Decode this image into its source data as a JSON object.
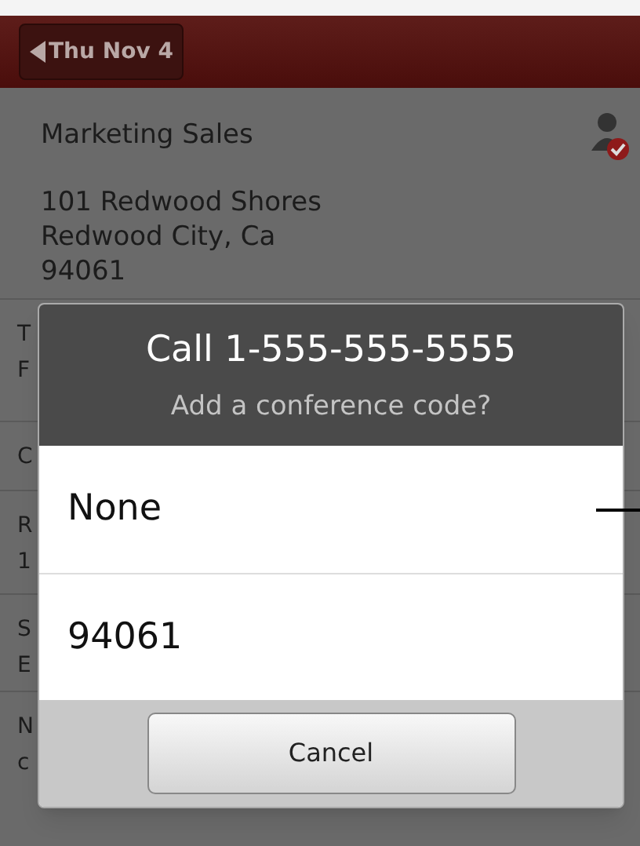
{
  "header": {
    "back_button": "Thu Nov 4"
  },
  "event": {
    "title": "Marketing Sales",
    "address": [
      "101 Redwood Shores",
      "Redwood City, Ca",
      "94061"
    ]
  },
  "background_rows": [
    {
      "lines": [
        "T",
        "F"
      ]
    },
    {
      "lines": [
        "C"
      ]
    },
    {
      "lines": [
        "R",
        "1"
      ]
    },
    {
      "lines": [
        "S",
        "E"
      ]
    },
    {
      "lines": [
        "N",
        "c"
      ]
    }
  ],
  "dialog": {
    "title": "Call 1-555-555-5555",
    "subtitle": "Add a conference code?",
    "options": [
      {
        "label": "None"
      },
      {
        "label": "94061"
      }
    ],
    "cancel": "Cancel"
  }
}
